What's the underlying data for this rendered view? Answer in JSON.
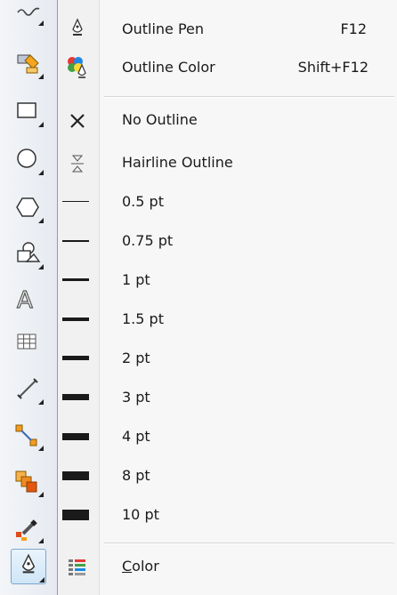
{
  "menu": {
    "items": [
      {
        "label": "Outline Pen",
        "shortcut": "F12",
        "icon": "outline-pen-icon"
      },
      {
        "label": "Outline Color",
        "shortcut": "Shift+F12",
        "icon": "outline-color-icon"
      },
      {
        "label": "No Outline",
        "icon": "x-icon"
      },
      {
        "label": "Hairline Outline",
        "icon": "hairline-icon"
      },
      {
        "label": "0.5 pt"
      },
      {
        "label": "0.75 pt"
      },
      {
        "label": "1 pt"
      },
      {
        "label": "1.5 pt"
      },
      {
        "label": "2 pt"
      },
      {
        "label": "3 pt"
      },
      {
        "label": "4 pt"
      },
      {
        "label": "8 pt"
      },
      {
        "label": "10 pt"
      },
      {
        "label_rest": "olor",
        "mnemonic": "C",
        "icon": "color-icon"
      }
    ]
  },
  "toolbox": {
    "tools": [
      "freehand-tool-icon",
      "smart-fill-tool-icon",
      "rectangle-tool-icon",
      "ellipse-tool-icon",
      "polygon-tool-icon",
      "basic-shapes-tool-icon",
      "text-tool-icon",
      "table-tool-icon",
      "dimension-tool-icon",
      "connector-tool-icon",
      "blend-tool-icon",
      "eyedropper-tool-icon",
      "outline-tool-icon"
    ]
  },
  "colors": {
    "accent": "#7aa7cf",
    "text": "#1a1a1a",
    "menu_bg": "#f7f7f7",
    "toolbox_bg": "#e6eaf0"
  }
}
